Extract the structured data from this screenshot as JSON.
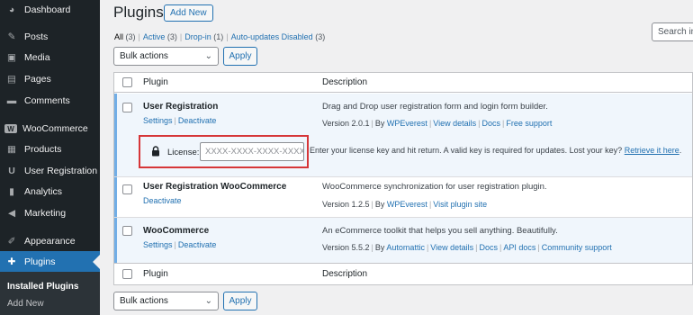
{
  "sidebar": {
    "items": [
      {
        "label": "Dashboard",
        "icon": "dashboard-icon",
        "glyph": "◕"
      },
      {
        "label": "Posts",
        "icon": "pin-icon",
        "glyph": "✎"
      },
      {
        "label": "Media",
        "icon": "media-icon",
        "glyph": "▣"
      },
      {
        "label": "Pages",
        "icon": "pages-icon",
        "glyph": "▤"
      },
      {
        "label": "Comments",
        "icon": "comments-icon",
        "glyph": "▬"
      },
      {
        "label": "WooCommerce",
        "icon": "woocommerce-icon",
        "glyph": "W"
      },
      {
        "label": "Products",
        "icon": "products-icon",
        "glyph": "▦"
      },
      {
        "label": "User Registration",
        "icon": "user-registration-icon",
        "glyph": "U"
      },
      {
        "label": "Analytics",
        "icon": "analytics-icon",
        "glyph": "▮"
      },
      {
        "label": "Marketing",
        "icon": "marketing-icon",
        "glyph": "◀"
      },
      {
        "label": "Appearance",
        "icon": "appearance-icon",
        "glyph": "✐"
      },
      {
        "label": "Plugins",
        "icon": "plugins-icon",
        "glyph": "✚"
      }
    ],
    "submenu": [
      {
        "label": "Installed Plugins"
      },
      {
        "label": "Add New"
      }
    ]
  },
  "header": {
    "title": "Plugins",
    "add_new": "Add New"
  },
  "filters": {
    "all": "All",
    "all_count": "(3)",
    "active": "Active",
    "active_count": "(3)",
    "dropin": "Drop-in",
    "dropin_count": "(1)",
    "autoupdates": "Auto-updates Disabled",
    "autoupdates_count": "(3)"
  },
  "search": {
    "placeholder": "Search in"
  },
  "bulk": {
    "label": "Bulk actions",
    "apply": "Apply"
  },
  "table": {
    "col_plugin": "Plugin",
    "col_description": "Description",
    "plugins": [
      {
        "name": "User Registration",
        "actions": [
          "Settings",
          "Deactivate"
        ],
        "description": "Drag and Drop user registration form and login form builder.",
        "version": "Version 2.0.1",
        "by": "By",
        "author": "WPEverest",
        "links": [
          "View details",
          "Docs",
          "Free support"
        ]
      },
      {
        "name": "User Registration WooCommerce",
        "actions": [
          "Deactivate"
        ],
        "description": "WooCommerce synchronization for user registration plugin.",
        "version": "Version 1.2.5",
        "by": "By",
        "author": "WPEverest",
        "links": [
          "Visit plugin site"
        ]
      },
      {
        "name": "WooCommerce",
        "actions": [
          "Settings",
          "Deactivate"
        ],
        "description": "An eCommerce toolkit that helps you sell anything. Beautifully.",
        "version": "Version 5.5.2",
        "by": "By",
        "author": "Automattic",
        "links": [
          "View details",
          "Docs",
          "API docs",
          "Community support"
        ]
      }
    ],
    "license": {
      "label": "License:",
      "placeholder": "XXXX-XXXX-XXXX-XXXX",
      "message": "Enter your license key and hit return. A valid key is required for updates. Lost your key?",
      "link": "Retrieve it here",
      "link_suffix": "."
    }
  }
}
